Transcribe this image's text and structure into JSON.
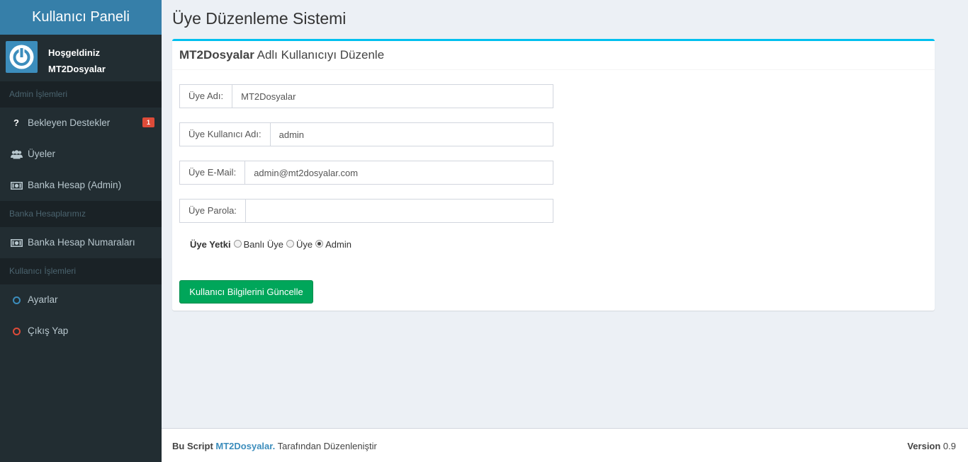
{
  "sidebar": {
    "brand": "Kullanıcı Paneli",
    "welcome": "Hoşgeldiniz",
    "username": "MT2Dosyalar",
    "sections": [
      {
        "header": "Admin İşlemleri"
      },
      {
        "header": "Banka Hesaplarımız"
      },
      {
        "header": "Kullanıcı İşlemleri"
      }
    ],
    "items": [
      {
        "label": "Bekleyen Destekler",
        "icon": "question-icon",
        "badge": "1"
      },
      {
        "label": "Üyeler",
        "icon": "users-icon"
      },
      {
        "label": "Banka Hesap (Admin)",
        "icon": "money-icon"
      },
      {
        "label": "Banka Hesap Numaraları",
        "icon": "money-icon"
      },
      {
        "label": "Ayarlar",
        "icon": "circle-icon",
        "color": "#3c8dbc"
      },
      {
        "label": "Çıkış Yap",
        "icon": "circle-icon",
        "color": "#dd4b39"
      }
    ]
  },
  "main": {
    "title": "Üye Düzenleme Sistemi",
    "box": {
      "title_bold": "MT2Dosyalar",
      "title_rest": " Adlı Kullanıcıyı Düzenle"
    },
    "form": {
      "fields": [
        {
          "label": "Üye Adı:",
          "value": "MT2Dosyalar"
        },
        {
          "label": "Üye Kullanıcı Adı:",
          "value": "admin"
        },
        {
          "label": "Üye E-Mail:",
          "value": "admin@mt2dosyalar.com"
        },
        {
          "label": "Üye Parola:",
          "value": ""
        }
      ],
      "permission_label": "Üye Yetki",
      "permission_options": [
        {
          "label": "Banlı Üye",
          "checked": false
        },
        {
          "label": "Üye",
          "checked": false
        },
        {
          "label": "Admin",
          "checked": true
        }
      ],
      "submit_label": "Kullanıcı Bilgilerini Güncelle"
    }
  },
  "footer": {
    "prefix": "Bu Script ",
    "link": "MT2Dosyalar.",
    "suffix": " Tarafından Düzenleniştir",
    "version_label": "Version",
    "version_value": " 0.9"
  },
  "colors": {
    "brand": "#367fa9",
    "sidebar_bg": "#222d32",
    "accent_top": "#00c0ef",
    "success": "#00a65a",
    "badge": "#dd4b39"
  }
}
